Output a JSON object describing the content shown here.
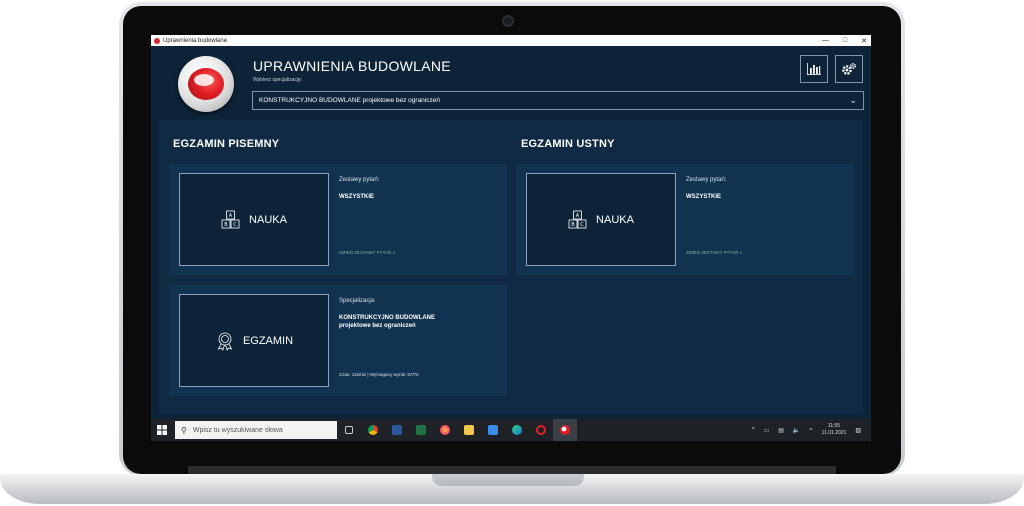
{
  "window": {
    "title": "Uprawnienia budowlane"
  },
  "header": {
    "app_title": "UPRAWNIENIA BUDOWLANE",
    "spec_label": "Wybierz specjalizację:",
    "selected_spec": "KONSTRUKCYJNO BUDOWLANE projektowe bez ograniczeń"
  },
  "sections": {
    "written": {
      "title": "EGZAMIN PISEMNY",
      "study_card": {
        "button_label": "NAUKA",
        "info_label": "Zestawy pytań:",
        "info_value": "WSZYSTKIE",
        "link": "ZMIEŃ ZESTAWY PYTAŃ »"
      },
      "exam_card": {
        "button_label": "EGZAMIN",
        "info_label": "Specjalizacja:",
        "info_value_line1": "KONSTRUKCYJNO BUDOWLANE",
        "info_value_line2": "projektowe bez ograniczeń",
        "meta": "Czas: 115min | Wymagany wynik: 57/75"
      }
    },
    "oral": {
      "title": "EGZAMIN USTNY",
      "study_card": {
        "button_label": "NAUKA",
        "info_label": "Zestawy pytań:",
        "info_value": "WSZYSTKIE",
        "link": "ZMIEŃ ZESTAWY PYTAŃ »"
      }
    }
  },
  "taskbar": {
    "search_placeholder": "Wpisz tu wyszukiwane słowa",
    "time": "11:55",
    "date": "11.01.2021",
    "apps": [
      "task-view",
      "chrome",
      "word",
      "excel",
      "firefox",
      "file-explorer",
      "photos",
      "edge",
      "opera",
      "uprawnienia"
    ]
  },
  "colors": {
    "background": "#0d2438",
    "panel": "#0f2a42",
    "card": "#123350",
    "accent_red": "#d6282c",
    "link_green": "#7fae96"
  }
}
